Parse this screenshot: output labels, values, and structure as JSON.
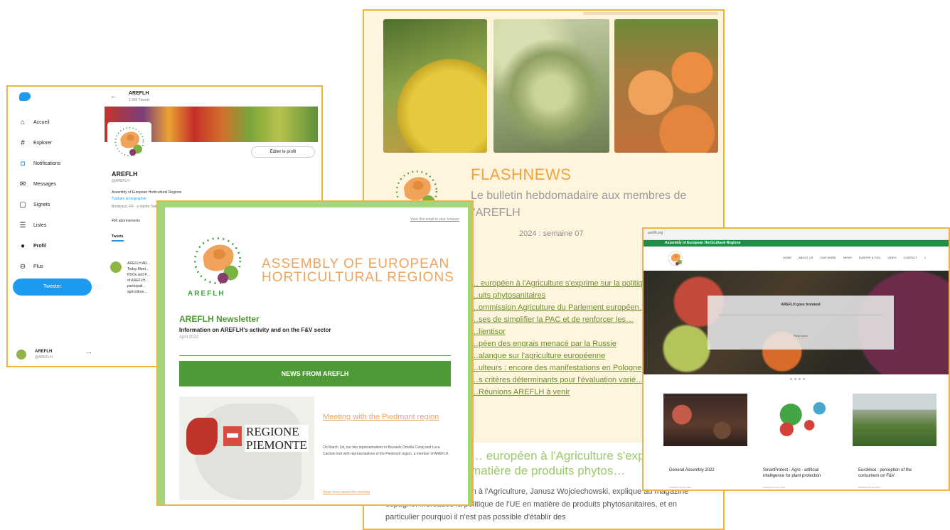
{
  "flashnews": {
    "title": "FLASHNEWS",
    "subtitle": "Le bulletin hebdomadaire aux membres de l'AREFLH",
    "week": "2024 : semaine 07",
    "links": [
      "… européen à l'Agriculture s'exprime sur la politique…",
      "…uits phytosanitaires",
      "…ommission Agriculture du Parlement européen…",
      "…ses de simplifier la PAC et de renforcer les…",
      "…lientisor",
      "…péen des engrais menacé par la Russie",
      "…alanque sur l'agriculture européenne",
      "…ulteurs : encore des manifestations en Pologne",
      "…s critères déterminants pour l'évaluation varié…",
      "…Réunions AREFLH à venir"
    ],
    "article_heading": "… européen à l'Agriculture s'exprime … E en matière de produits phytos…",
    "article_body": "… Commissaire européen à l'Agriculture, Janusz Wojciechowski, explique au magazine espagnol Mercados la politique de l'UE en matière de produits phytosanitaires, et en particulier pourquoi il n'est pas possible d'établir des"
  },
  "twitter": {
    "nav": [
      {
        "icon": "home-icon",
        "glyph": "⌂",
        "label": "Accueil"
      },
      {
        "icon": "hashtag-icon",
        "glyph": "#",
        "label": "Explorer"
      },
      {
        "icon": "bell-icon",
        "glyph": "◘",
        "label": "Notifications"
      },
      {
        "icon": "mail-icon",
        "glyph": "✉",
        "label": "Messages"
      },
      {
        "icon": "bookmark-icon",
        "glyph": "▢",
        "label": "Signets"
      },
      {
        "icon": "list-icon",
        "glyph": "☰",
        "label": "Listes"
      },
      {
        "icon": "profile-icon",
        "glyph": "●",
        "label": "Profil"
      },
      {
        "icon": "more-icon",
        "glyph": "⊖",
        "label": "Plus"
      }
    ],
    "tweet_button": "Tweeter",
    "account_name": "AREFLH",
    "account_handle": "@AREFLH",
    "header_title": "AREFLH",
    "header_count": "1 966 Tweets",
    "edit_profile": "Éditer le profil",
    "profile_name": "AREFLH",
    "profile_handle": "@AREFLH",
    "bio": "Assembly of European Horticultural Regions",
    "bio_link": "Traduire la biographie",
    "meta": "Bordeaux, FR · a rejoint Twitter",
    "stats": "456 abonnements",
    "tab": "Tweets",
    "tweet_lines": [
      "AREFLH AR…",
      "Today Meet…",
      "PDOs and P…",
      "of AREFLH…",
      "participati…",
      "agriculture…"
    ]
  },
  "newsletter": {
    "view_online": "View this email in your browser",
    "assembly_line1": "ASSEMBLY OF EUROPEAN",
    "assembly_line2": "HORTICULTURAL REGIONS",
    "logo_text": "AREFLH",
    "title": "AREFLH Newsletter",
    "subtitle": "Information on AREFLH's activity and on the F&V sector",
    "date": "April 2022",
    "news_bar": "NEWS FROM AREFLH",
    "map_line1": "REGIONE",
    "map_line2": "PIEMONTE",
    "meeting_title": "Meeting with the Piedmont region",
    "meeting_body": "On March 1st, our two representatives in Brussels Ornella Cenaj and Luca Cardoni met with representatives of the Piedmont region, a member of AREFLH.",
    "read_more": "Read more about the meeting"
  },
  "website": {
    "address": "areflh.org",
    "green_bar": "Assembly of European Horticultural Regions",
    "menu": [
      "HOME",
      "ABOUT US",
      "OUR WORK",
      "NEWS",
      "EUROPE & YOU",
      "VIDEO",
      "CONTACT"
    ],
    "hero_title": "AREFLH goes frontend",
    "hero_more": "Read more",
    "cards": [
      {
        "caption": "General Assembly 2022",
        "date": "Published 25 Mar 2022"
      },
      {
        "caption": "SmartProtect - Agro - artificial intelligence for plant protection",
        "date": "Published 10 Feb 2022"
      },
      {
        "caption": "EuroMoxi : perception of the consumers on F&V",
        "date": "Published 05 Jan 2022"
      }
    ]
  },
  "colors": {
    "frame_border": "#f2b33d",
    "areflh_orange": "#f0a35b",
    "areflh_green": "#4d9a36",
    "twitter_blue": "#1d9bf0",
    "web_green": "#1f8f45"
  }
}
